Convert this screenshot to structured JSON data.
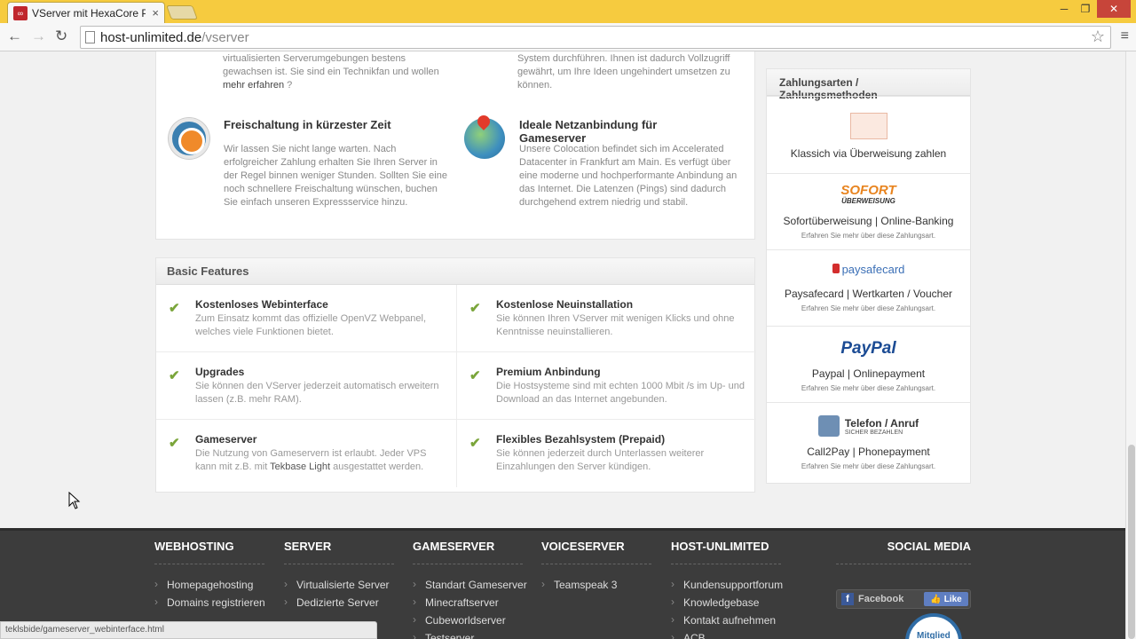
{
  "browser": {
    "tab_title": "VServer mit HexaCore Pro",
    "tab_favicon": "∞",
    "url_host": "host-unlimited.de",
    "url_path": "/vserver",
    "status_url": "teklsbide/gameserver_webinterface.html"
  },
  "top_cards": {
    "left_prev_text": "virtualisierten Serverumgebungen bestens gewachsen ist. Sie sind ein Technikfan und wollen ",
    "left_prev_link": "mehr erfahren",
    "left_prev_end": " ?",
    "right_prev_text": "System durchführen. Ihnen ist dadurch Vollzugriff gewährt, um Ihre Ideen ungehindert umsetzen zu können.",
    "card1_title": "Freischaltung in kürzester Zeit",
    "card1_text": "Wir lassen Sie nicht lange warten. Nach erfolgreicher Zahlung erhalten Sie Ihren Server in der Regel binnen weniger Stunden. Sollten Sie eine noch schnellere Freischaltung wünschen, buchen Sie einfach unseren Expressservice hinzu.",
    "card2_title": "Ideale Netzanbindung für Gameserver",
    "card2_text": "Unsere Colocation befindet sich im Accelerated Datacenter in Frankfurt am Main. Es verfügt über eine moderne und hochperformante Anbindung an das Internet. Die Latenzen (Pings) sind dadurch durchgehend extrem niedrig und stabil."
  },
  "features": {
    "heading": "Basic Features",
    "items": [
      {
        "title": "Kostenloses Webinterface",
        "text": "Zum Einsatz kommt das offizielle OpenVZ Webpanel, welches viele Funktionen bietet."
      },
      {
        "title": "Kostenlose Neuinstallation",
        "text": "Sie können Ihren VServer mit wenigen Klicks und ohne Kenntnisse neuinstallieren."
      },
      {
        "title": "Upgrades",
        "text": "Sie können den VServer jederzeit automatisch erweitern lassen (z.B. mehr RAM)."
      },
      {
        "title": "Premium Anbindung",
        "text": "Die Hostsysteme sind mit echten 1000 Mbit /s im Up- und Download an das Internet angebunden."
      },
      {
        "title": "Gameserver",
        "text_a": "Die Nutzung von Gameservern ist erlaubt. Jeder VPS kann mit z.B. mit ",
        "link": "Tekbase Light",
        "text_b": " ausgestattet werden."
      },
      {
        "title": "Flexibles Bezahlsystem (Prepaid)",
        "text": "Sie können jederzeit durch Unterlassen weiterer Einzahlungen den Server kündigen."
      }
    ]
  },
  "payments": {
    "heading": "Zahlungsarten / Zahlungsmethoden",
    "items": [
      {
        "name": "Klassich via Überweisung zahlen",
        "sub": ""
      },
      {
        "logo": "SOFORT",
        "logo_sub": "ÜBERWEISUNG",
        "name": "Sofortüberweisung | Online-Banking",
        "sub": "Erfahren Sie mehr über diese Zahlungsart."
      },
      {
        "logo": "paysafecard",
        "name": "Paysafecard | Wertkarten / Voucher",
        "sub": "Erfahren Sie mehr über diese Zahlungsart."
      },
      {
        "logo": "PayPal",
        "name": "Paypal | Onlinepayment",
        "sub": "Erfahren Sie mehr über diese Zahlungsart."
      },
      {
        "logo": "Telefon / Anruf",
        "logo_sub": "SICHER BEZAHLEN",
        "name": "Call2Pay | Phonepayment",
        "sub": "Erfahren Sie mehr über diese Zahlungsart."
      }
    ]
  },
  "footer": {
    "columns": [
      {
        "heading": "WEBHOSTING",
        "links": [
          "Homepagehosting",
          "Domains registrieren"
        ]
      },
      {
        "heading": "SERVER",
        "links": [
          "Virtualisierte Server",
          "Dedizierte Server"
        ]
      },
      {
        "heading": "GAMESERVER",
        "links": [
          "Standart Gameserver",
          "Minecraftserver",
          "Cubeworldserver",
          "Testserver"
        ]
      },
      {
        "heading": "VOICESERVER",
        "links": [
          "Teamspeak 3"
        ]
      },
      {
        "heading": "HOST-UNLIMITED",
        "links": [
          "Kundensupportforum",
          "Knowledgebase",
          "Kontakt aufnehmen",
          "ACB"
        ]
      }
    ],
    "social_heading": "SOCIAL MEDIA",
    "facebook_label": "Facebook",
    "like_label": "Like",
    "badge_label": "Mitglied"
  },
  "colors": {
    "chrome": "#f6cb3f",
    "footer": "#3c3c3c",
    "check": "#7aa53a"
  }
}
